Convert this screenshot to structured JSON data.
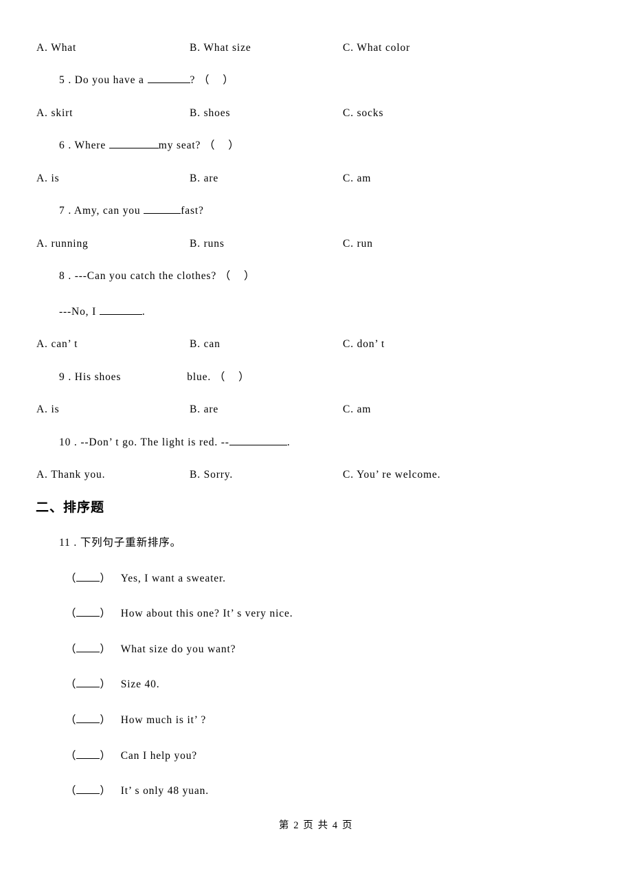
{
  "document": {
    "type": "exam-worksheet",
    "language": "zh-CN",
    "background_color": "#ffffff",
    "text_color": "#000000"
  },
  "questions": [
    {
      "number": "4",
      "stem_visible": false,
      "options": {
        "a": "A. What",
        "b": "B. What size",
        "c": "C. What color"
      }
    },
    {
      "number": "5",
      "stem_pre": "5 . Do you have a ",
      "stem_post": "? （    ）",
      "blank": "blank-m",
      "options": {
        "a": "A. skirt",
        "b": "B. shoes",
        "c": "C. socks"
      }
    },
    {
      "number": "6",
      "stem_pre": "6 . Where ",
      "stem_post": "my seat? （    ）",
      "blank": "blank-l",
      "options": {
        "a": "A. is",
        "b": "B. are",
        "c": "C. am"
      }
    },
    {
      "number": "7",
      "stem_pre": "7 . Amy, can you ",
      "stem_post": "fast?",
      "blank": "blank-s",
      "options": {
        "a": "A. running",
        "b": "B. runs",
        "c": "C. run"
      }
    },
    {
      "number": "8",
      "stem_pre": "8 . ---Can you catch the clothes? （    ）",
      "stem_post": "",
      "continuation_pre": "---No, I ",
      "continuation_post": ".",
      "blank": "blank-m",
      "options": {
        "a": "A. can’ t",
        "b": "B. can",
        "c": "C. don’ t"
      }
    },
    {
      "number": "9",
      "stem_pre": "9 . His shoes",
      "stem_post": "blue. （    ）",
      "blank": "gap",
      "options": {
        "a": "A. is",
        "b": "B. are",
        "c": "C. am"
      }
    },
    {
      "number": "10",
      "stem_pre": "10 . --Don’ t go. The light is red. --",
      "stem_post": ".",
      "blank": "blank-xl",
      "options": {
        "a": "A. Thank you.",
        "b": "B. Sorry.",
        "c": "C. You’ re welcome."
      }
    }
  ],
  "section_two": {
    "heading": "二、排序题",
    "question_number": "11 . ",
    "question_text": "下列句子重新排序。",
    "items": [
      "Yes, I want a sweater.",
      "How about this one? It’ s very nice.",
      "What size do you want?",
      "Size 40.",
      "How much is it’ ?",
      "Can I help you?",
      "It’ s only 48 yuan."
    ]
  },
  "footer": {
    "text": "第 2 页 共 4 页"
  }
}
